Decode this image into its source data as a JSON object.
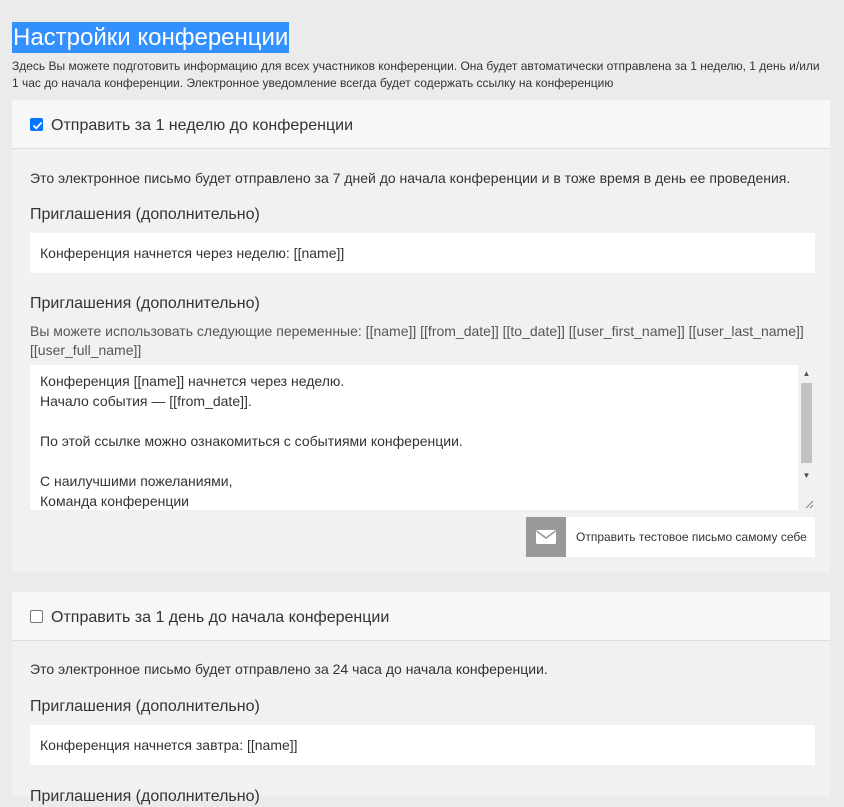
{
  "title": "Настройки конференции",
  "intro": "Здесь Вы можете подготовить информацию для всех участников конференции. Она будет автоматически отправлена за 1 неделю, 1 день и/или 1 час до начала конференции. Электронное уведомление всегда будет содержать ссылку на конференцию",
  "week": {
    "checked": true,
    "title": "Отправить за 1 неделю до конференции",
    "description": "Это электронное письмо будет отправлено за 7 дней до начала конференции и в тоже время в день ее проведения.",
    "subject_label": "Приглашения (дополнительно)",
    "subject_value": "Конференция начнется через неделю: [[name]]",
    "body_label": "Приглашения (дополнительно)",
    "vars_hint": "Вы можете использовать следующие переменные: [[name]] [[from_date]] [[to_date]] [[user_first_name]] [[user_last_name]] [[user_full_name]]",
    "body_lines": [
      "Конференция [[name]] начнется через неделю.",
      "Начало события — [[from_date]].",
      "",
      "По этой ссылке можно ознакомиться с событиями конференции.",
      "",
      "С наилучшими пожеланиями,",
      "Команда конференции"
    ],
    "test_button": "Отправить тестовое письмо самому себе",
    "test_icon": "envelope-icon"
  },
  "day": {
    "checked": false,
    "title": "Отправить за 1 день до начала конференции",
    "description": "Это электронное письмо будет отправлено за 24 часа до начала конференции.",
    "subject_label": "Приглашения (дополнительно)",
    "subject_value": "Конференция начнется завтра: [[name]]",
    "body_label": "Приглашения (дополнительно)"
  },
  "colors": {
    "selection": "#3390ff",
    "checkbox": "#0075ff",
    "icon_bg": "#999999"
  }
}
